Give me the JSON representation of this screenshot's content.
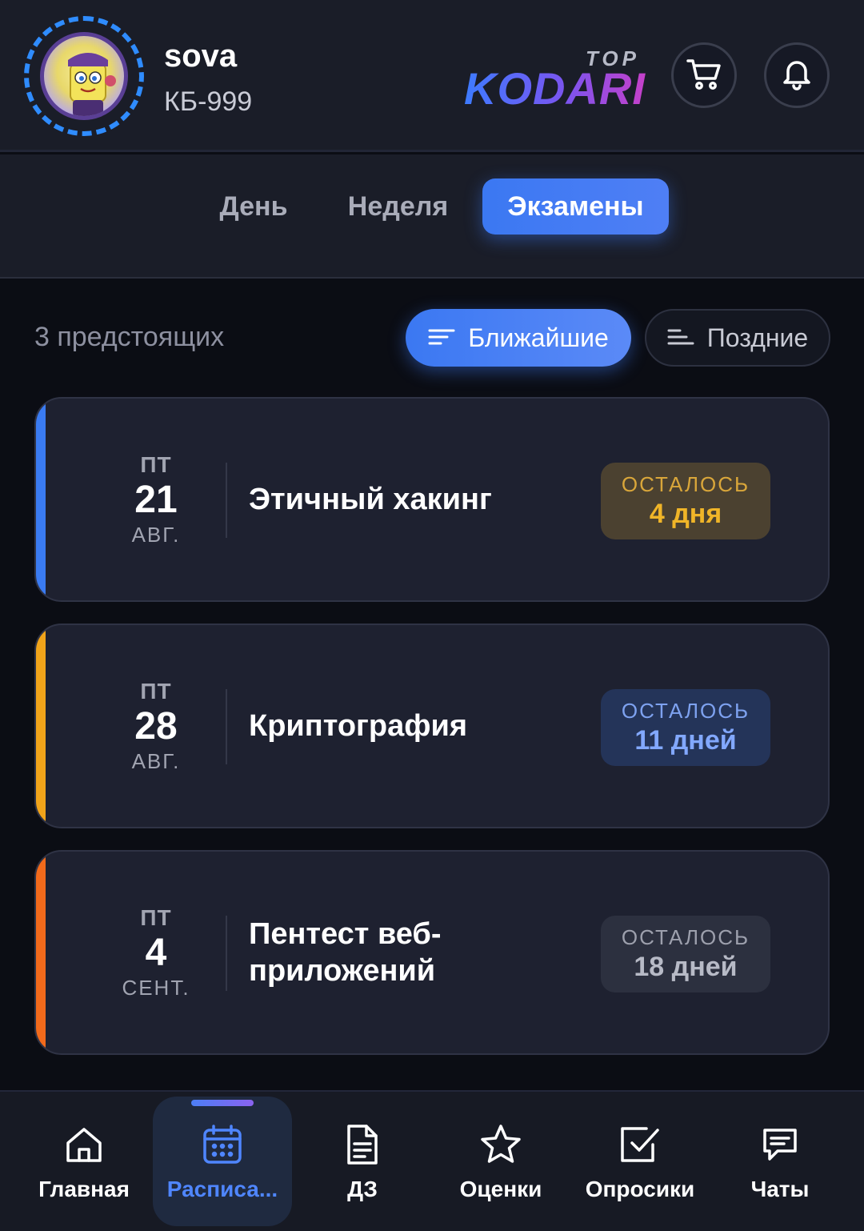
{
  "user": {
    "name": "sova",
    "group": "КБ-999"
  },
  "brand": {
    "top": "TOP",
    "main": "KODARI"
  },
  "tabs": [
    {
      "label": "День",
      "active": false
    },
    {
      "label": "Неделя",
      "active": false
    },
    {
      "label": "Экзамены",
      "active": true
    }
  ],
  "summary": "3 предстоящих",
  "filters": [
    {
      "label": "Ближайшие",
      "active": true
    },
    {
      "label": "Поздние",
      "active": false
    }
  ],
  "exams": [
    {
      "weekday": "ПТ",
      "day": "21",
      "month": "АВГ.",
      "title": "Этичный хакинг",
      "remaining_label": "ОСТАЛОСЬ",
      "remaining_value": "4 дня",
      "accent_color": "#3a7bf2",
      "badge_bg": "#4b4130",
      "badge_label_color": "#d9a63a",
      "badge_value_color": "#f0b528"
    },
    {
      "weekday": "ПТ",
      "day": "28",
      "month": "АВГ.",
      "title": "Криптография",
      "remaining_label": "ОСТАЛОСЬ",
      "remaining_value": "11 дней",
      "accent_color": "#f1a41a",
      "badge_bg": "#243459",
      "badge_label_color": "#7ea2f0",
      "badge_value_color": "#82a8ff"
    },
    {
      "weekday": "ПТ",
      "day": "4",
      "month": "СЕНТ.",
      "title": "Пентест веб-приложений",
      "remaining_label": "ОСТАЛОСЬ",
      "remaining_value": "18 дней",
      "accent_color": "#f26a1b",
      "badge_bg": "#2c303f",
      "badge_label_color": "#9da0ad",
      "badge_value_color": "#b7bac6"
    }
  ],
  "nav": [
    {
      "label": "Главная",
      "icon": "home-icon",
      "active": false
    },
    {
      "label": "Расписа...",
      "icon": "calendar-icon",
      "active": true
    },
    {
      "label": "ДЗ",
      "icon": "document-icon",
      "active": false
    },
    {
      "label": "Оценки",
      "icon": "star-icon",
      "active": false
    },
    {
      "label": "Опросики",
      "icon": "checkbox-icon",
      "active": false
    },
    {
      "label": "Чаты",
      "icon": "chat-icon",
      "active": false
    }
  ],
  "colors": {
    "accent": "#3b78f2",
    "active_nav_label": "#4f86ff"
  }
}
